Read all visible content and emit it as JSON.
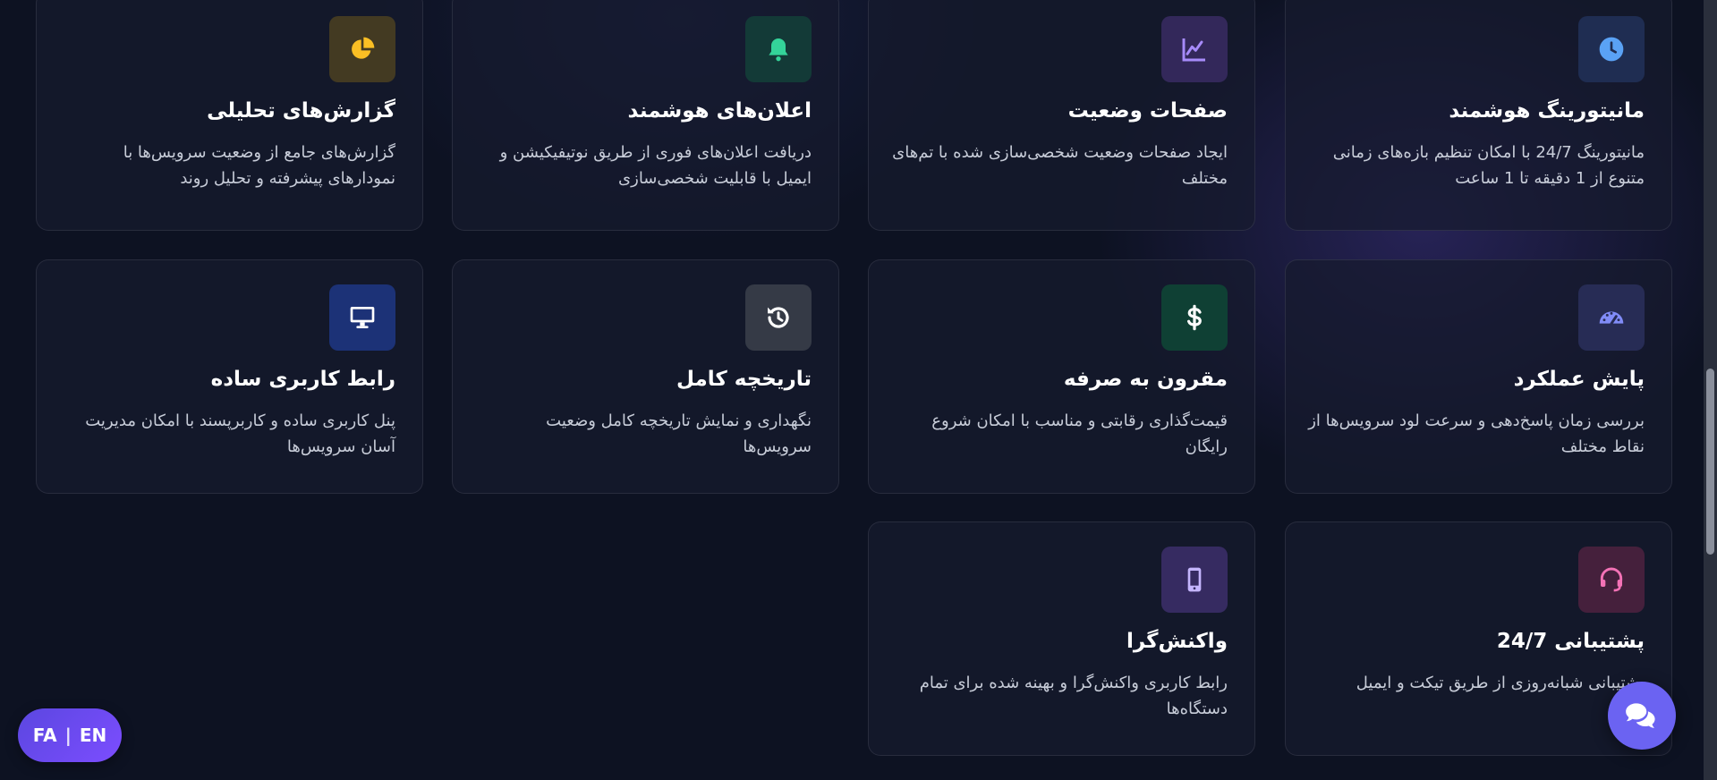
{
  "features": [
    {
      "id": "monitoring",
      "title": "مانیتورینگ هوشمند",
      "desc": "مانیتورینگ 24/7 با امکان تنظیم بازه‌های زمانی متنوع از 1 دقیقه تا 1 ساعت",
      "icon": "clock-icon",
      "icon_color": "#5aa2f5",
      "icon_bg": "#1f2d52"
    },
    {
      "id": "status-pages",
      "title": "صفحات وضعیت",
      "desc": "ایجاد صفحات وضعیت شخصی‌سازی شده با تم‌های مختلف",
      "icon": "chart-line-icon",
      "icon_color": "#a78bfa",
      "icon_bg": "#33285a"
    },
    {
      "id": "alerts",
      "title": "اعلان‌های هوشمند",
      "desc": "دریافت اعلان‌های فوری از طریق نوتیفیکیشن و ایمیل با قابلیت شخصی‌سازی",
      "icon": "bell-icon",
      "icon_color": "#34d399",
      "icon_bg": "#133a37"
    },
    {
      "id": "reports",
      "title": "گزارش‌های تحلیلی",
      "desc": "گزارش‌های جامع از وضعیت سرویس‌ها با نمودارهای پیشرفته و تحلیل روند",
      "icon": "pie-chart-icon",
      "icon_color": "#fbbf24",
      "icon_bg": "#433a22"
    },
    {
      "id": "performance",
      "title": "پایش عملکرد",
      "desc": "بررسی زمان پاسخ‌دهی و سرعت لود سرویس‌ها از نقاط مختلف",
      "icon": "gauge-icon",
      "icon_color": "#818cf8",
      "icon_bg": "#272c55"
    },
    {
      "id": "pricing",
      "title": "مقرون به صرفه",
      "desc": "قیمت‌گذاری رقابتی و مناسب با امکان شروع رایگان",
      "icon": "dollar-icon",
      "icon_color": "#ffffff",
      "icon_bg": "#0f4034"
    },
    {
      "id": "history",
      "title": "تاریخچه کامل",
      "desc": "نگهداری و نمایش تاریخچه کامل وضعیت سرویس‌ها",
      "icon": "history-icon",
      "icon_color": "#ffffff",
      "icon_bg": "#353a46"
    },
    {
      "id": "ui",
      "title": "رابط کاربری ساده",
      "desc": "پنل کاربری ساده و کاربرپسند با امکان مدیریت آسان سرویس‌ها",
      "icon": "desktop-icon",
      "icon_color": "#ffffff",
      "icon_bg": "#1c3277"
    },
    {
      "id": "support",
      "title": "پشتیبانی 24/7",
      "desc": "پشتیبانی شبانه‌روزی از طریق تیکت و ایمیل",
      "icon": "headset-icon",
      "icon_color": "#f472b6",
      "icon_bg": "#45203c"
    },
    {
      "id": "responsive",
      "title": "واکنش‌گرا",
      "desc": "رابط کاربری واکنش‌گرا و بهینه شده برای تمام دستگاه‌ها",
      "icon": "mobile-icon",
      "icon_color": "#c4b5fd",
      "icon_bg": "#362b61"
    }
  ],
  "language_toggle": {
    "fa": "FA",
    "separator": "|",
    "en": "EN"
  },
  "chat_button": {
    "icon": "chat-bubbles-icon"
  }
}
